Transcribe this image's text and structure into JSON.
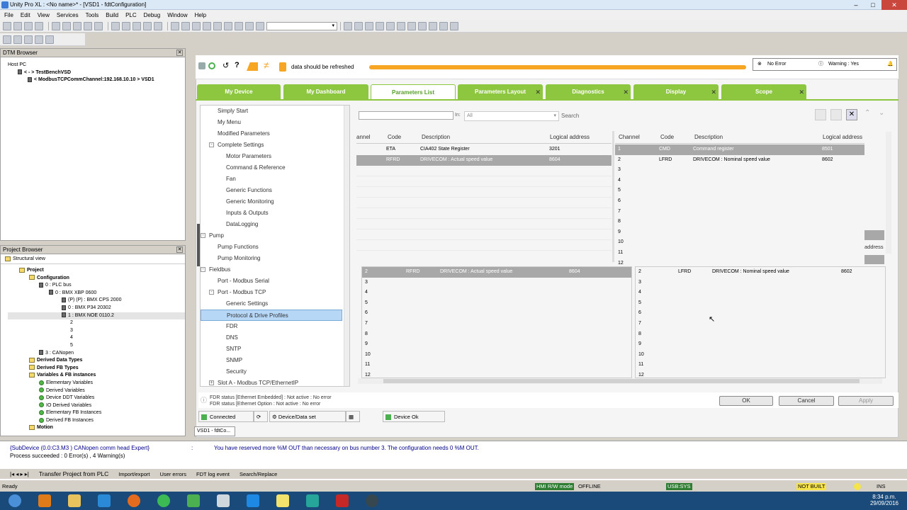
{
  "window": {
    "title": "Unity Pro XL : <No name>* - [VSD1 - fdtConfiguration]"
  },
  "menu": [
    "File",
    "Edit",
    "View",
    "Services",
    "Tools",
    "Build",
    "PLC",
    "Debug",
    "Window",
    "Help"
  ],
  "dtm_browser": {
    "title": "DTM Browser",
    "items": [
      "Host PC",
      "< - > TestBenchVSD",
      "< ModbusTCPCommChannel:192.168.10.10 > VSD1"
    ]
  },
  "project_browser": {
    "title": "Project Browser",
    "view": "Structural view",
    "items": [
      "Project",
      "Configuration",
      "0 : PLC bus",
      "0 : BMX XBP 0600",
      "(P) (P) : BMX CPS 2000",
      "0 : BMX P34 20302",
      "1 : BMX NOE 0110.2",
      "2",
      "3",
      "4",
      "5",
      "3 : CANopen",
      "Derived Data Types",
      "Derived FB Types",
      "Variables & FB instances",
      "Elementary Variables",
      "Derived Variables",
      "Device DDT Variables",
      "IO Derived Variables",
      "Elementary FB Instances",
      "Derived FB Instances",
      "Motion"
    ]
  },
  "dtm_header": {
    "refresh_text": "data should be refreshed",
    "no_error": "No Error",
    "warning": "Warning : Yes"
  },
  "tabs": [
    "My Device",
    "My Dashboard",
    "Parameters List",
    "Parameters Layout",
    "Diagnostics",
    "Display",
    "Scope"
  ],
  "active_tab": "Parameters List",
  "nav": [
    {
      "label": "Simply Start",
      "lvl": 1
    },
    {
      "label": "My Menu",
      "lvl": 1
    },
    {
      "label": "Modified Parameters",
      "lvl": 1
    },
    {
      "label": "Complete Settings",
      "lvl": 1,
      "exp": "−"
    },
    {
      "label": "Motor Parameters",
      "lvl": 2
    },
    {
      "label": "Command & Reference",
      "lvl": 2
    },
    {
      "label": "Fan",
      "lvl": 2
    },
    {
      "label": "Generic Functions",
      "lvl": 2
    },
    {
      "label": "Generic Monitoring",
      "lvl": 2
    },
    {
      "label": "Inputs & Outputs",
      "lvl": 2
    },
    {
      "label": "DataLogging",
      "lvl": 2
    },
    {
      "label": "Pump",
      "lvl": 0,
      "exp": "−"
    },
    {
      "label": "Pump Functions",
      "lvl": 1
    },
    {
      "label": "Pump Monitoring",
      "lvl": 1
    },
    {
      "label": "Fieldbus",
      "lvl": 0,
      "exp": "−"
    },
    {
      "label": "Port - Modbus Serial",
      "lvl": 1
    },
    {
      "label": "Port - Modbus TCP",
      "lvl": 1,
      "exp": "−"
    },
    {
      "label": "Generic Settings",
      "lvl": 2
    },
    {
      "label": "Protocol & Drive Profiles",
      "lvl": 2,
      "sel": true
    },
    {
      "label": "FDR",
      "lvl": 2
    },
    {
      "label": "DNS",
      "lvl": 2
    },
    {
      "label": "SNTP",
      "lvl": 2
    },
    {
      "label": "SNMP",
      "lvl": 2
    },
    {
      "label": "Security",
      "lvl": 2
    },
    {
      "label": "Slot A - Modbus TCP/EthernetIP",
      "lvl": 1,
      "exp": "+"
    }
  ],
  "search": {
    "in_label": "In:",
    "scope": "All",
    "button": "Search"
  },
  "left_table": {
    "headers": [
      "annel",
      "Code",
      "Description",
      "Logical address"
    ],
    "rows": [
      {
        "code": "ETA",
        "desc": "CIA402 State Register",
        "addr": "3201",
        "sel": false
      },
      {
        "code": "RFRD",
        "desc": "DRIVECOM : Actual speed value",
        "addr": "8604",
        "sel": true
      }
    ]
  },
  "right_table": {
    "headers": [
      "Channel",
      "Code",
      "Description",
      "Logical address"
    ],
    "rows": [
      {
        "ch": "1",
        "code": "CMD",
        "desc": "Command register",
        "addr": "8501",
        "sel": true
      },
      {
        "ch": "2",
        "code": "LFRD",
        "desc": "DRIVECOM : Nominal speed value",
        "addr": "8602",
        "sel": false
      },
      {
        "ch": "3"
      },
      {
        "ch": "4"
      },
      {
        "ch": "5"
      },
      {
        "ch": "6"
      },
      {
        "ch": "7"
      },
      {
        "ch": "8"
      },
      {
        "ch": "9"
      },
      {
        "ch": "10"
      },
      {
        "ch": "11"
      },
      {
        "ch": "12"
      }
    ],
    "peek_header": "address"
  },
  "bottom_left": {
    "rows": [
      {
        "ch": "2",
        "code": "RFRD",
        "desc": "DRIVECOM : Actual speed value",
        "addr": "8604",
        "sel": true
      },
      {
        "ch": "3"
      },
      {
        "ch": "4"
      },
      {
        "ch": "5"
      },
      {
        "ch": "6"
      },
      {
        "ch": "7"
      },
      {
        "ch": "8"
      },
      {
        "ch": "9"
      },
      {
        "ch": "10"
      },
      {
        "ch": "11"
      },
      {
        "ch": "12"
      }
    ]
  },
  "bottom_right": {
    "rows": [
      {
        "ch": "2",
        "code": "LFRD",
        "desc": "DRIVECOM : Nominal speed value",
        "addr": "8602"
      },
      {
        "ch": "3"
      },
      {
        "ch": "4"
      },
      {
        "ch": "5"
      },
      {
        "ch": "6"
      },
      {
        "ch": "7"
      },
      {
        "ch": "8"
      },
      {
        "ch": "9"
      },
      {
        "ch": "10"
      },
      {
        "ch": "11"
      },
      {
        "ch": "12"
      }
    ]
  },
  "fdr_status": [
    "FDR status [Ethernet Embedded] : Not active : No error",
    "FDR status [Ethernet Option : Not active : No error"
  ],
  "buttons": {
    "ok": "OK",
    "cancel": "Cancel",
    "apply": "Apply"
  },
  "dtm_status": {
    "connected": "Connected",
    "device_data": "Device/Data set",
    "device_ok": "Device Ok"
  },
  "doc_tab": "VSD1 - fdtCo...",
  "output": {
    "line1_src": "{SubDevice (0.0:C3.M3 ) CANopen comm head Expert}",
    "line1_sep": ":",
    "line1_msg": "You have reserved more %M OUT than necessary on bus number 3. The configuration needs 0 %M OUT.",
    "line2": "Process succeeded : 0 Error(s) , 4 Warning(s)"
  },
  "bottom_tabs": [
    "Transfer Project from PLC",
    "Import/export",
    "User errors",
    "FDT log event",
    "Search/Replace"
  ],
  "statusbar": {
    "ready": "Ready",
    "hmi": "HMI R/W mode",
    "offline": "OFFLINE",
    "usb": "USB:SYS",
    "not_built": "NOT BUILT",
    "ins": "INS"
  },
  "clock": {
    "time": "8:34 p.m.",
    "date": "29/09/2016"
  },
  "colors": {
    "tab_green": "#8dc63f",
    "progress_orange": "#f6a623",
    "selection_blue": "#b7d7f7",
    "row_gray": "#a8a8a8"
  }
}
